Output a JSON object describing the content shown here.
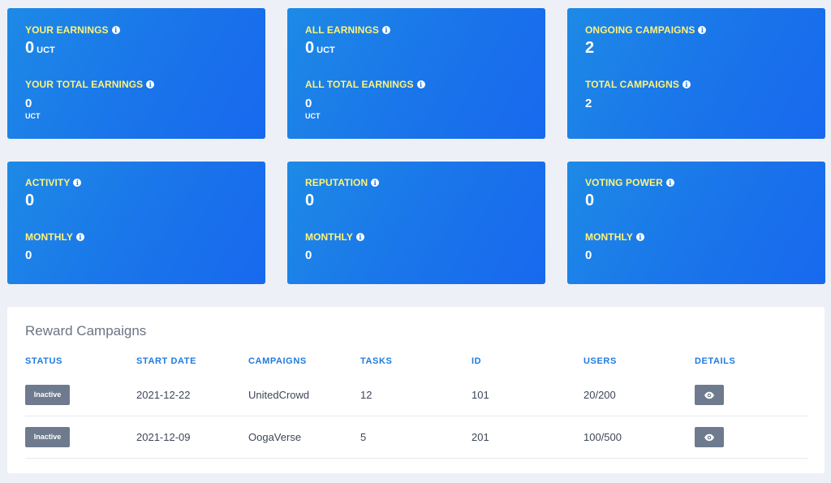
{
  "cards": {
    "your_earnings": {
      "label": "YOUR EARNINGS",
      "value": "0",
      "unit": "UCT",
      "sub_label": "YOUR TOTAL EARNINGS",
      "sub_value": "0",
      "sub_unit": "UCT"
    },
    "all_earnings": {
      "label": "ALL EARNINGS",
      "value": "0",
      "unit": "UCT",
      "sub_label": "ALL TOTAL EARNINGS",
      "sub_value": "0",
      "sub_unit": "UCT"
    },
    "campaigns": {
      "label": "ONGOING CAMPAIGNS",
      "value": "2",
      "sub_label": "TOTAL CAMPAIGNS",
      "sub_value": "2"
    },
    "activity": {
      "label": "ACTIVITY",
      "value": "0",
      "sub_label": "MONTHLY",
      "sub_value": "0"
    },
    "reputation": {
      "label": "REPUTATION",
      "value": "0",
      "sub_label": "MONTHLY",
      "sub_value": "0"
    },
    "voting_power": {
      "label": "VOTING POWER",
      "value": "0",
      "sub_label": "MONTHLY",
      "sub_value": "0"
    }
  },
  "info_glyph": "i",
  "reward_campaigns": {
    "title": "Reward Campaigns",
    "columns": [
      "STATUS",
      "START DATE",
      "CAMPAIGNS",
      "TASKS",
      "ID",
      "USERS",
      "DETAILS"
    ],
    "rows": [
      {
        "status": "Inactive",
        "start_date": "2021-12-22",
        "campaign": "UnitedCrowd",
        "tasks": "12",
        "id": "101",
        "users": "20/200"
      },
      {
        "status": "Inactive",
        "start_date": "2021-12-09",
        "campaign": "OogaVerse",
        "tasks": "5",
        "id": "201",
        "users": "100/500"
      }
    ]
  },
  "colors": {
    "card_blue": "#1a74ea",
    "label_yellow": "#fff27a",
    "header_blue": "#1f7be0",
    "badge_gray": "#6e7b8e"
  },
  "icons": {
    "info": "info-icon",
    "details": "eye-icon"
  }
}
